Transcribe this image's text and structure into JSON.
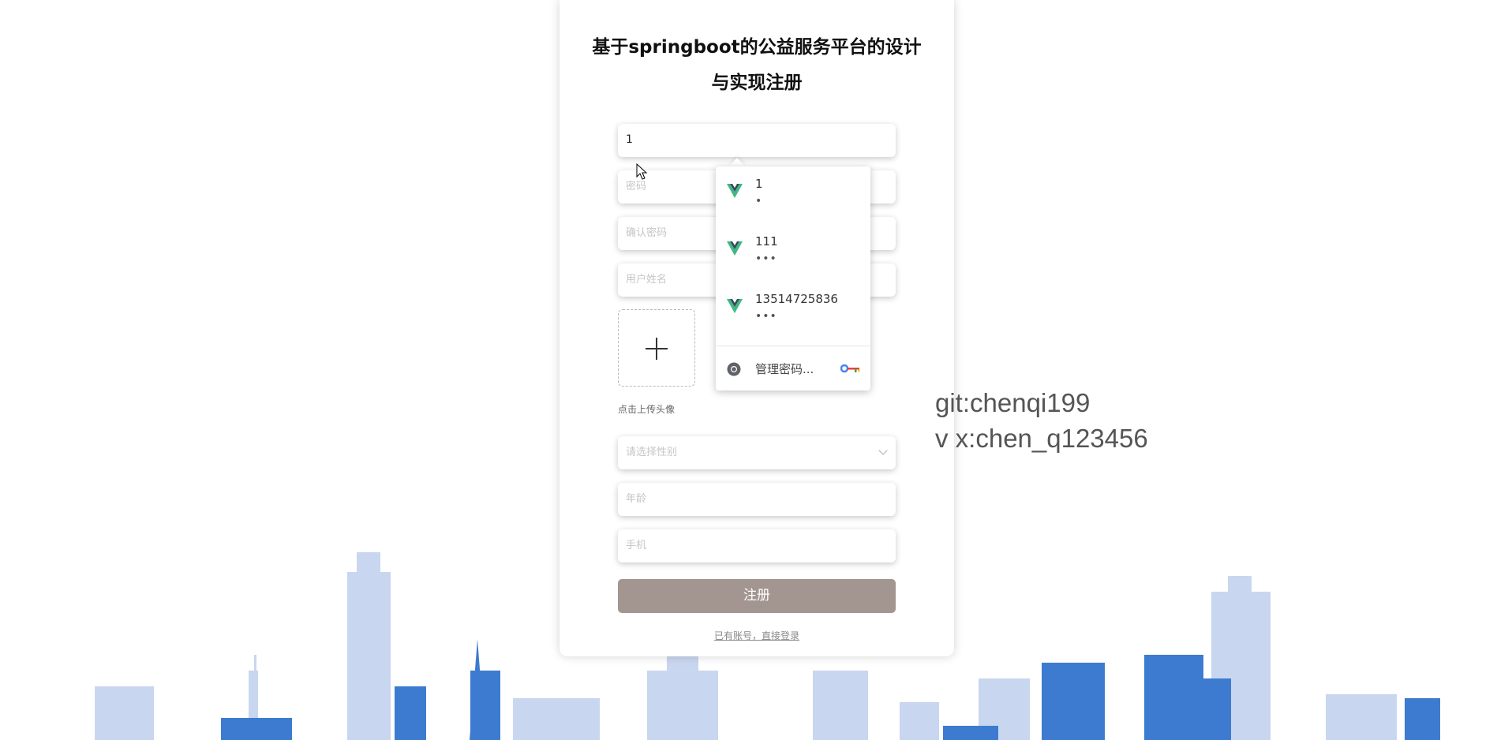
{
  "form": {
    "title": "基于springboot的公益服务平台的设计与实现注册",
    "account_value": "1",
    "password_placeholder": "密码",
    "confirm_placeholder": "确认密码",
    "name_placeholder": "用户姓名",
    "upload_hint": "点击上传头像",
    "gender_placeholder": "请选择性别",
    "age_placeholder": "年龄",
    "phone_placeholder": "手机",
    "submit_label": "注册",
    "login_link": "已有账号，直接登录"
  },
  "autofill": {
    "suggestions": [
      {
        "user": "1",
        "masked": "•"
      },
      {
        "user": "111",
        "masked": "•••"
      },
      {
        "user": "13514725836",
        "masked": "•••"
      }
    ],
    "manage_label": "管理密码..."
  },
  "watermark": {
    "line1": "git:chenqi199",
    "line2": "v x:chen_q123456"
  },
  "colors": {
    "submit": "#a39691",
    "skyline_light": "#c9d6ef",
    "skyline_dark": "#3d7bd0",
    "vue_green": "#41b883",
    "vue_dark": "#35495e"
  },
  "icons": {
    "upload": "plus-icon",
    "gender": "chevron-down-icon",
    "suggestion": "vue-logo-icon",
    "manage": "chrome-icon",
    "key": "key-icon"
  }
}
